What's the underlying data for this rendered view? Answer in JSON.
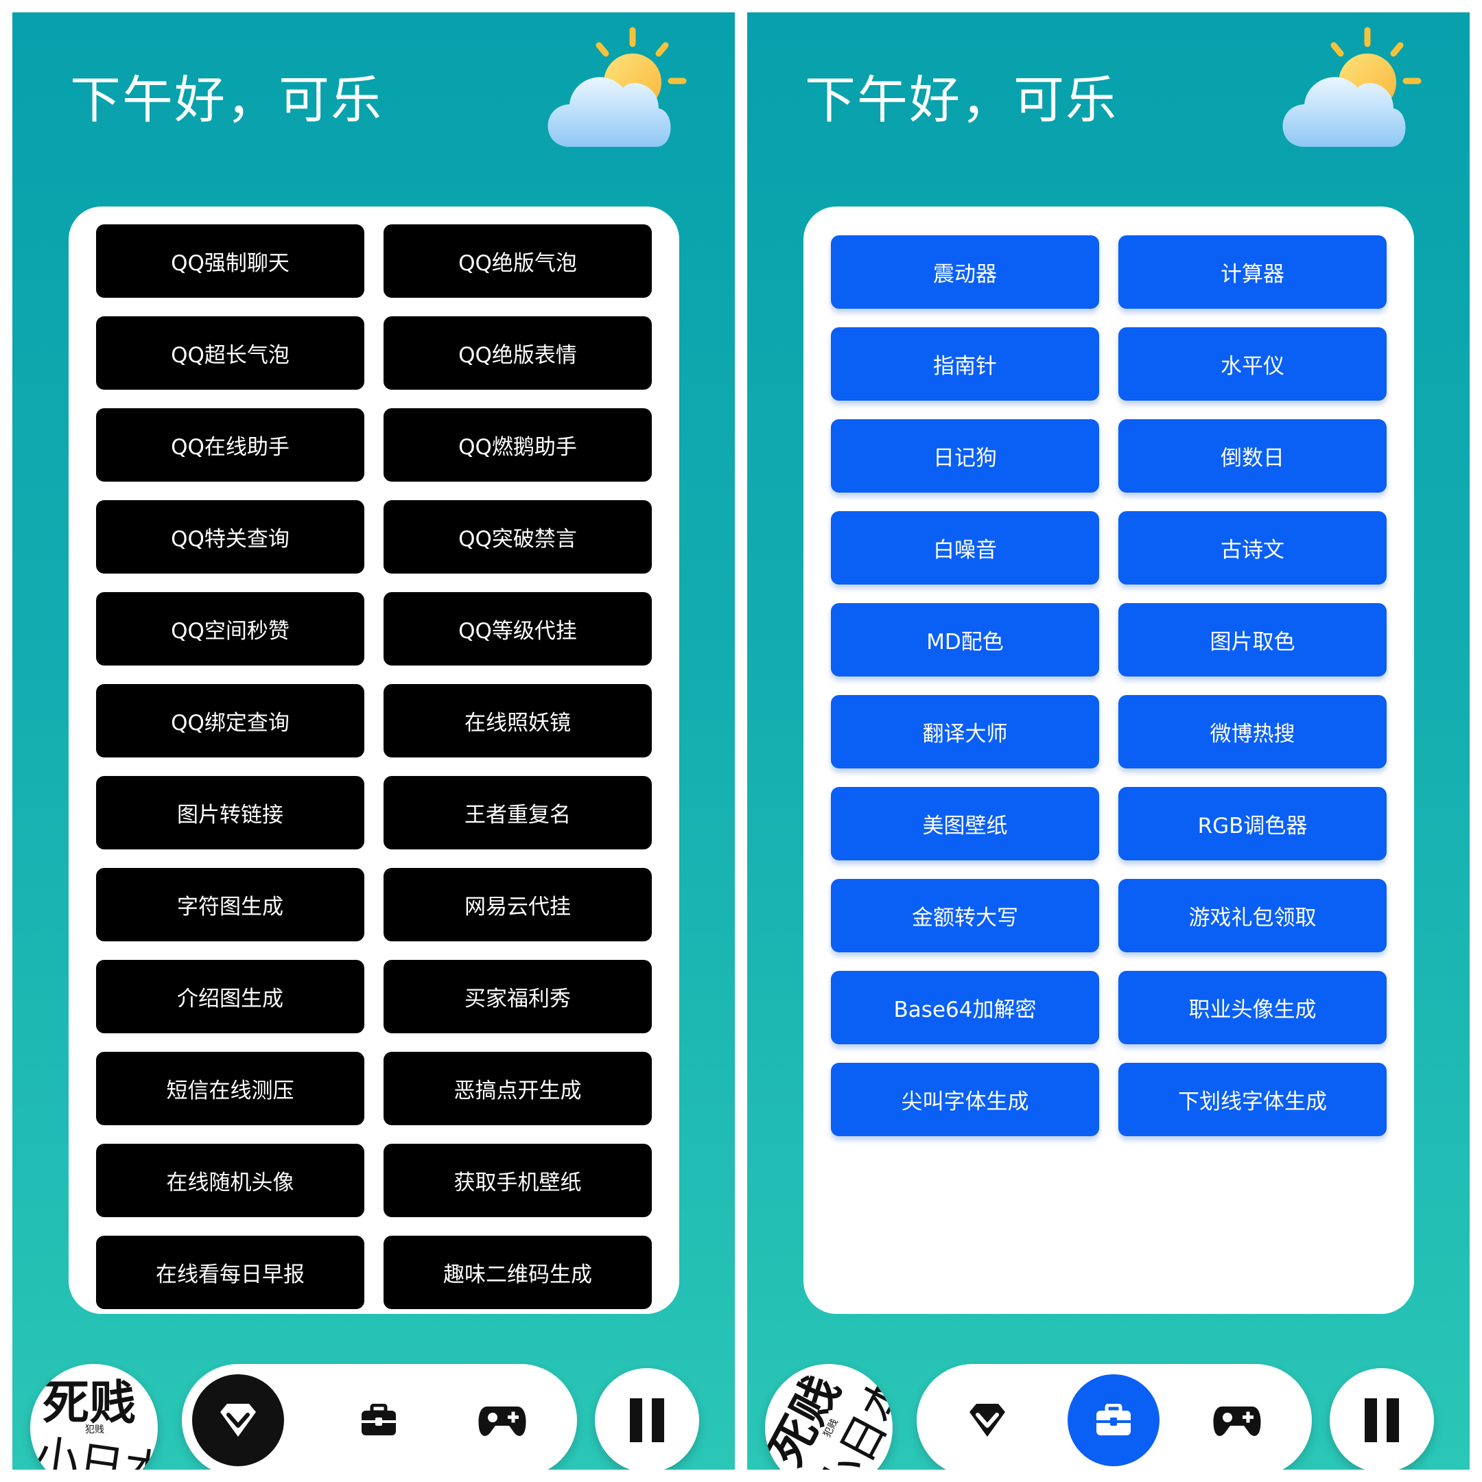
{
  "left_screen": {
    "greeting": "下午好，可乐",
    "buttons": [
      "QQ强制聊天",
      "QQ绝版气泡",
      "QQ超长气泡",
      "QQ绝版表情",
      "QQ在线助手",
      "QQ燃鹅助手",
      "QQ特关查询",
      "QQ突破禁言",
      "QQ空间秒赞",
      "QQ等级代挂",
      "QQ绑定查询",
      "在线照妖镜",
      "图片转链接",
      "王者重复名",
      "字符图生成",
      "网易云代挂",
      "介绍图生成",
      "买家福利秀",
      "短信在线测压",
      "恶搞点开生成",
      "在线随机头像",
      "获取手机壁纸",
      "在线看每日早报",
      "趣味二维码生成"
    ],
    "active_nav": "home"
  },
  "right_screen": {
    "greeting": "下午好，可乐",
    "buttons": [
      "震动器",
      "计算器",
      "指南针",
      "水平仪",
      "日记狗",
      "倒数日",
      "白噪音",
      "古诗文",
      "MD配色",
      "图片取色",
      "翻译大师",
      "微博热搜",
      "美图壁纸",
      "RGB调色器",
      "金额转大写",
      "游戏礼包领取",
      "Base64加解密",
      "职业头像生成",
      "尖叫字体生成",
      "下划线字体生成"
    ],
    "active_nav": "tools"
  },
  "avatar": {
    "line1": "死贱",
    "small": "犯贱",
    "line2": "小日本"
  },
  "nav_icons": [
    "diamond-icon",
    "briefcase-icon",
    "gamepad-icon"
  ],
  "colors": {
    "bg_top": "#07a0ac",
    "bg_bottom": "#2ac6b6",
    "dark_button": "#000000",
    "blue_button": "#0a5ff5",
    "active_nav_left": "#111111",
    "active_nav_right": "#0a5ff5"
  }
}
